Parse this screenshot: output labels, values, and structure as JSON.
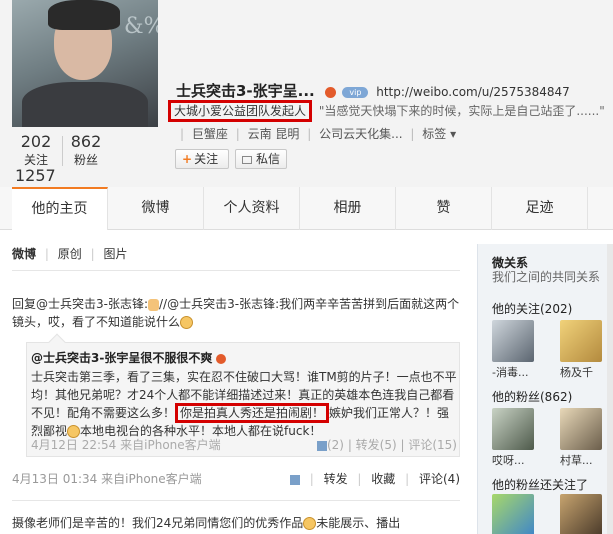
{
  "profile": {
    "name": "士兵突击3-张宇呈...",
    "verified_badge": "vip",
    "url": "http://weibo.com/u/2575384847",
    "bio_highlight": "大城小爱公益团队发起人",
    "bio_quote": "\"当感觉天快塌下来的时候，实际上是自己站歪了......\"",
    "info": [
      "巨蟹座",
      "云南 昆明",
      "公司云天化集...",
      "标签 ▾"
    ],
    "avatar_bg_text": "&%S",
    "stats": {
      "follow_count": "202",
      "follow_label": "关注",
      "fans_count": "862",
      "fans_label": "粉丝",
      "weibo_count": "1257"
    },
    "follow_button": "关注",
    "message_button": "私信"
  },
  "tabs": [
    "他的主页",
    "微博",
    "个人资料",
    "相册",
    "赞",
    "足迹"
  ],
  "subnav": {
    "active": "微博",
    "items": [
      "原创",
      "图片"
    ]
  },
  "post": {
    "text_a": "回复@士兵突击3-张志锋:",
    "text_b": "//@士兵突击3-张志锋:我们两辛辛苦苦拼到后面就这两个镜头，哎，看了不知道能说什么",
    "quote": {
      "author": "@士兵突击3-张宇呈很不服很不爽",
      "body_a": "士兵突击第三季，看了三集，实在忍不住破口大骂！谁TM剪的片子！一点也不平均！其他兄弟呢？才24个人都不能详细描述过来！真正的英雄本色连我自己都看不见！配角不需要这么多！",
      "body_highlight": "你是拍真人秀还是拍闹剧！",
      "body_b": "嫉妒我们正常人？！强烈鄙视",
      "body_c": "本地电视台的各种水平！本地人都在说fuck！",
      "time": "4月12日 22:54",
      "source": "来自iPhone客户端",
      "likes": "(2)",
      "repost": "转发(5)",
      "comment": "评论(15)"
    },
    "time": "4月13日 01:34",
    "source": "来自iPhone客户端",
    "actions": [
      "转发",
      "收藏",
      "评论(4)"
    ]
  },
  "post2": {
    "text": "摄像老师们是辛苦的！我们24兄弟同情您们的优秀作品",
    "text_b": "未能展示、播出"
  },
  "sidebar": {
    "title": "微关系",
    "subtitle": "我们之间的共同关系",
    "follow_header": "他的关注(202)",
    "follow_names": [
      "-消毒...",
      "杨及千"
    ],
    "fans_header": "他的粉丝(862)",
    "fans_names": [
      "哎呀...",
      "村草..."
    ],
    "also_header": "他的粉丝还关注了"
  }
}
